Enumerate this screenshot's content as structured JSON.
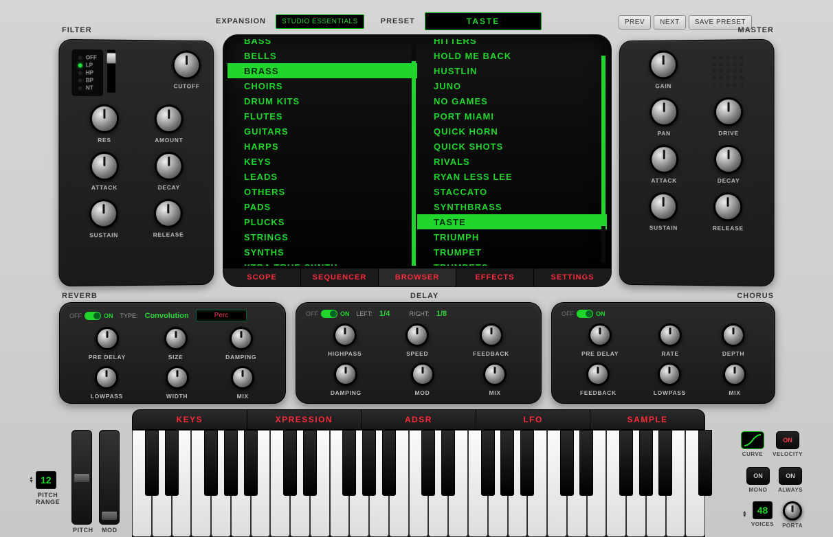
{
  "header": {
    "expansion_label": "EXPANSION",
    "expansion_value": "STUDIO ESSENTIALS",
    "preset_label": "PRESET",
    "preset_value": "TASTE",
    "prev": "PREV",
    "next": "NEXT",
    "save": "SAVE PRESET"
  },
  "panels": {
    "filter": "FILTER",
    "master": "MASTER",
    "reverb": "REVERB",
    "delay": "DELAY",
    "chorus": "CHORUS"
  },
  "filter": {
    "modes": [
      "OFF",
      "LP",
      "HP",
      "BP",
      "NT"
    ],
    "active_mode": "LP",
    "cutoff": "CUTOFF",
    "res": "RES",
    "amount": "AMOUNT",
    "attack": "ATTACK",
    "decay": "DECAY",
    "sustain": "SUSTAIN",
    "release": "RELEASE"
  },
  "master": {
    "gain": "GAIN",
    "pan": "PAN",
    "drive": "DRIVE",
    "attack": "ATTACK",
    "decay": "DECAY",
    "sustain": "SUSTAIN",
    "release": "RELEASE"
  },
  "browser": {
    "categories": [
      "BASS",
      "BELLS",
      "BRASS",
      "CHOIRS",
      "DRUM KITS",
      "FLUTES",
      "GUITARS",
      "HARPS",
      "KEYS",
      "LEADS",
      "OTHERS",
      "PADS",
      "PLUCKS",
      "STRINGS",
      "SYNTHS",
      "XTRA TRUE SYNTH"
    ],
    "selected_category": "BRASS",
    "presets": [
      "HITTERS",
      "HOLD ME BACK",
      "HUSTLIN",
      "JUNO",
      "NO GAMES",
      "PORT MIAMI",
      "QUICK HORN",
      "QUICK SHOTS",
      "RIVALS",
      "RYAN LESS LEE",
      "STACCATO",
      "SYNTHBRASS",
      "TASTE",
      "TRIUMPH",
      "TRUMPET",
      "TRUMPETS"
    ],
    "selected_preset": "TASTE"
  },
  "tabs": {
    "scope": "SCOPE",
    "sequencer": "SEQUENCER",
    "browser": "BROWSER",
    "effects": "EFFECTS",
    "settings": "SETTINGS"
  },
  "fx": {
    "off": "OFF",
    "on": "ON",
    "type_label": "TYPE:",
    "reverb_type": "Convolution",
    "reverb_preset": "Perc",
    "pre_delay": "PRE DELAY",
    "size": "SIZE",
    "damping": "DAMPING",
    "lowpass": "LOWPASS",
    "width": "WIDTH",
    "mix": "MIX",
    "left": "LEFT:",
    "left_val": "1/4",
    "right": "RIGHT:",
    "right_val": "1/8",
    "highpass": "HIGHPASS",
    "speed": "SPEED",
    "feedback": "FEEDBACK",
    "mod": "MOD",
    "rate": "RATE",
    "depth": "DEPTH"
  },
  "bottom_tabs": {
    "keys": "KEYS",
    "xpression": "XPRESSION",
    "adsr": "ADSR",
    "lfo": "LFO",
    "sample": "SAMPLE"
  },
  "footer": {
    "pitch_range_val": "12",
    "pitch_range": "PITCH\nRANGE",
    "pitch": "PITCH",
    "mod": "MOD",
    "curve": "CURVE",
    "velocity": "VELOCITY",
    "mono": "MONO",
    "always": "ALWAYS",
    "voices": "VOICES",
    "voices_val": "48",
    "porta": "PORTA",
    "on": "ON"
  }
}
